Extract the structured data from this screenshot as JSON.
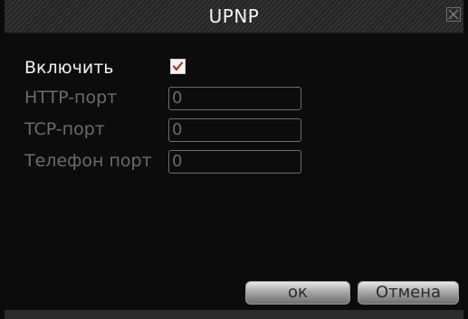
{
  "dialog": {
    "title": "UPNP",
    "close_icon": "close-icon"
  },
  "form": {
    "enable_label": "Включить",
    "enable_checked": true,
    "http_port_label": "HTTP-порт",
    "http_port_value": "0",
    "tcp_port_label": "TCP-порт",
    "tcp_port_value": "0",
    "phone_port_label": "Телефон порт",
    "phone_port_value": "0"
  },
  "buttons": {
    "ok_label": "ок",
    "cancel_label": "Отмена"
  },
  "colors": {
    "background": "#0c0c0c",
    "text_active": "#f2f2f2",
    "text_disabled": "#6b6b6b",
    "checkmark": "#c0262c"
  }
}
